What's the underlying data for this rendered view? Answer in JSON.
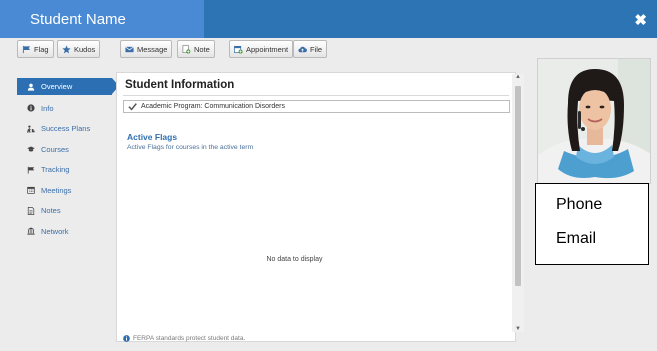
{
  "header": {
    "student_name": "Student Name",
    "close_glyph": "✖"
  },
  "toolbar": {
    "flag": "Flag",
    "kudos": "Kudos",
    "message": "Message",
    "note": "Note",
    "appointment": "Appointment",
    "file": "File"
  },
  "sidebar": {
    "items": [
      {
        "label": "Overview",
        "icon": "user-icon",
        "active": true
      },
      {
        "label": "Info",
        "icon": "info-icon"
      },
      {
        "label": "Success Plans",
        "icon": "success-plans-icon"
      },
      {
        "label": "Courses",
        "icon": "graduation-cap-icon"
      },
      {
        "label": "Tracking",
        "icon": "flag-icon"
      },
      {
        "label": "Meetings",
        "icon": "calendar-icon"
      },
      {
        "label": "Notes",
        "icon": "document-icon"
      },
      {
        "label": "Network",
        "icon": "institution-icon"
      }
    ]
  },
  "main": {
    "title": "Student Information",
    "program": "Academic Program: Communication Disorders",
    "flags_title": "Active Flags",
    "flags_subtitle": "Active Flags for courses in the active term",
    "empty_text": "No data to display",
    "footer": "FERPA standards protect student data."
  },
  "contact": {
    "phone": "Phone",
    "email": "Email"
  },
  "colors": {
    "header": "#2d74b5",
    "name_tab": "#4a8ad4",
    "active_nav": "#2d6fb3",
    "link": "#3a6ea8"
  }
}
